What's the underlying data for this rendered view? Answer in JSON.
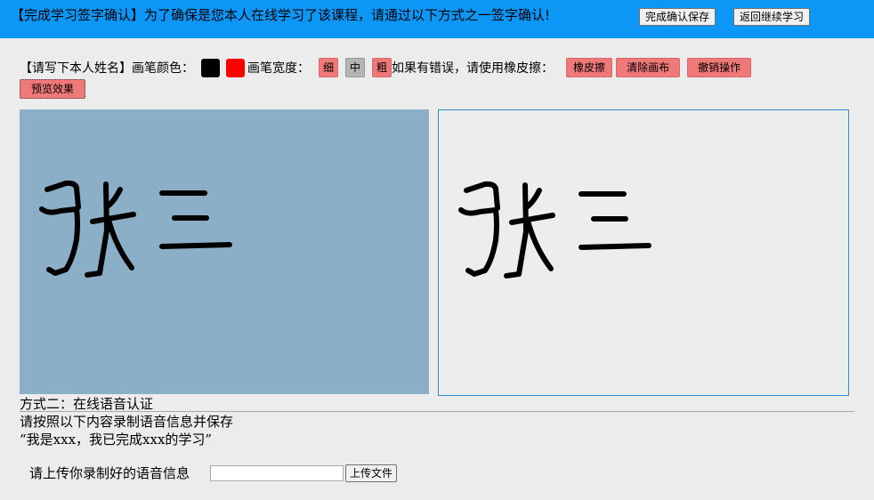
{
  "header": {
    "notice": "【完成学习签字确认】为了确保是您本人在线学习了该课程，请通过以下方式之一签字确认!",
    "save_label": "完成确认保存",
    "return_label": "返回继续学习"
  },
  "toolbar": {
    "name_prompt": "【请写下本人姓名】",
    "color_label": "画笔颜色：",
    "colors": [
      "#000000",
      "#ff0000"
    ],
    "width_label": "画笔宽度：",
    "widths": [
      "细",
      "中",
      "粗"
    ],
    "eraser_prompt": "如果有错误，请使用橡皮擦：",
    "eraser_label": "橡皮擦",
    "clear_label": "清除画布",
    "undo_label": "撤销操作",
    "preview_label": "预览效果"
  },
  "voice": {
    "title": "方式二：在线语音认证",
    "instruction": "请按照以下内容录制语音信息并保存",
    "quote": "“我是xxx，我已完成xxx的学习”",
    "upload_label": "请上传你录制好的语音信息",
    "upload_button": "上传文件"
  }
}
